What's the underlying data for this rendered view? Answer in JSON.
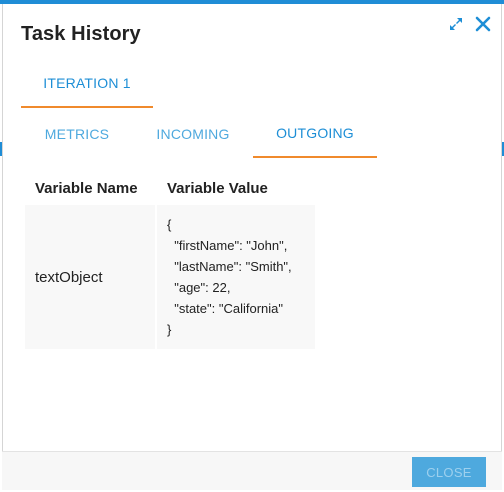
{
  "dialog": {
    "title": "Task History",
    "icons": {
      "maximize": "expand-arrows-icon",
      "close": "close-x-icon"
    }
  },
  "iteration_tabs": [
    {
      "label": "ITERATION 1",
      "active": true
    }
  ],
  "detail_tabs": [
    {
      "label": "METRICS",
      "active": false
    },
    {
      "label": "INCOMING",
      "active": false
    },
    {
      "label": "OUTGOING",
      "active": true
    }
  ],
  "variables_table": {
    "headers": [
      "Variable Name",
      "Variable Value"
    ],
    "rows": [
      {
        "name": "textObject",
        "value_lines": [
          "{",
          "  \"firstName\": \"John\",",
          "  \"lastName\": \"Smith\",",
          "  \"age\": 22,",
          "  \"state\": \"California\"",
          "}"
        ]
      }
    ]
  },
  "footer": {
    "close_label": "CLOSE"
  },
  "colors": {
    "accent": "#1f8dd6",
    "tab_text": "#4ea9de",
    "active_underline": "#f08a2c",
    "close_button": "#4ea9de"
  }
}
